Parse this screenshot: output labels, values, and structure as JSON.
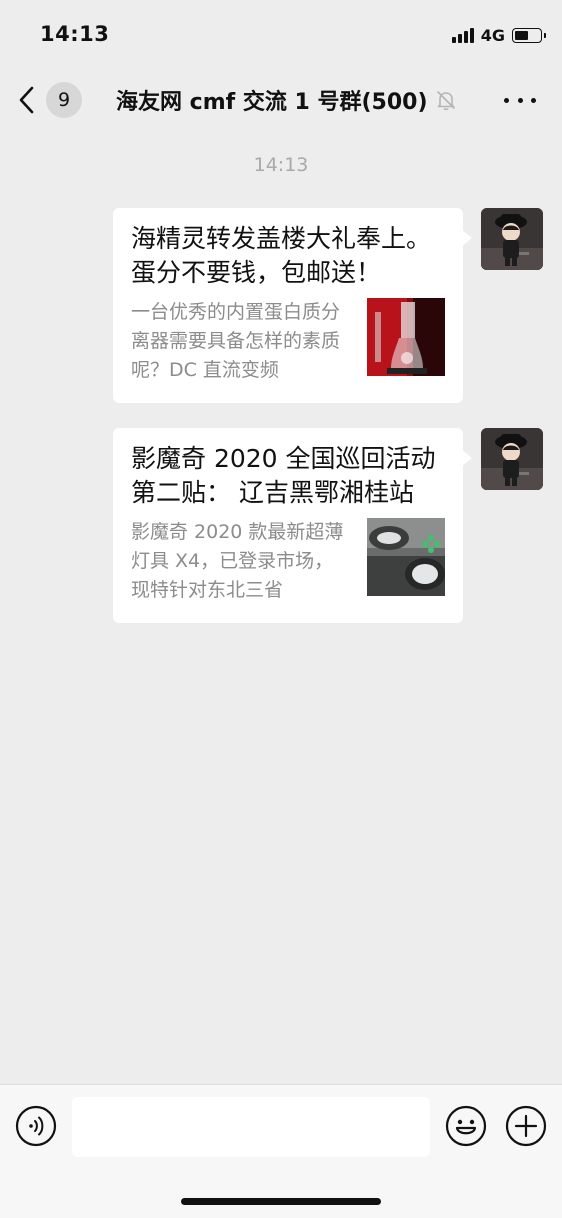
{
  "status_bar": {
    "time": "14:13",
    "network": "4G"
  },
  "nav": {
    "unread_count": "9",
    "title": "海友网 cmf 交流 1 号群(500)"
  },
  "chat": {
    "timestamp": "14:13",
    "messages": [
      {
        "title": "海精灵转发盖楼大礼奉上。蛋分不要钱，包邮送！",
        "desc": "一台优秀的内置蛋白质分离器需要具备怎样的素质呢？DC 直流变频",
        "thumb": "protein-skimmer-thumbnail"
      },
      {
        "title": "影魔奇 2020 全国巡回活动第二贴： 辽吉黑鄂湘桂站",
        "desc": "影魔奇 2020 款最新超薄灯具 X4，已登录市场，现特针对东北三省",
        "thumb": "led-light-thumbnail"
      }
    ]
  },
  "input_bar": {
    "placeholder": ""
  },
  "colors": {
    "background": "#ededed",
    "bubble": "#ffffff",
    "secondary_text": "#8c8c8c",
    "timestamp": "#a9a9a9"
  }
}
